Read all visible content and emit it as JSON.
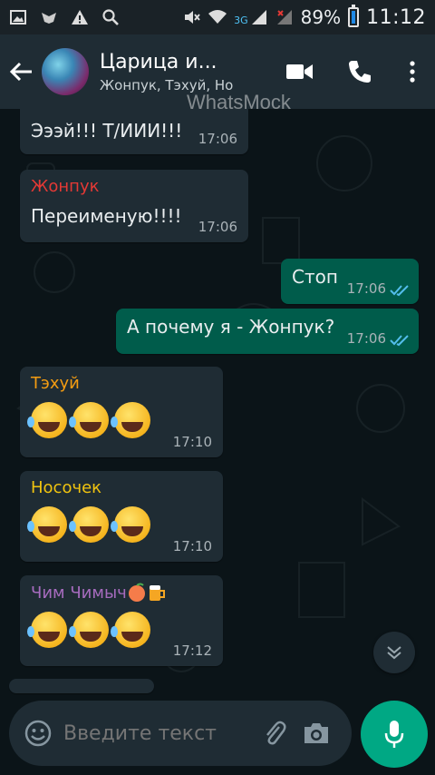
{
  "status_bar": {
    "network_label": "3G",
    "battery": "89%",
    "time": "11:12"
  },
  "header": {
    "title": "Царица и...",
    "subtitle": "Жонпук, Тэхуй, Но",
    "watermark": "WhatsMock"
  },
  "messages": [
    {
      "direction": "in",
      "text": "Эээй!!! Т/ИИИ!!!",
      "time": "17:06"
    },
    {
      "direction": "in",
      "sender": "Жонпук",
      "sender_color": "#e53935",
      "text": "Переименую!!!!",
      "time": "17:06"
    },
    {
      "direction": "out",
      "text": "Стоп",
      "time": "17:06",
      "status": "read"
    },
    {
      "direction": "out",
      "text": "А почему я - Жонпук?",
      "time": "17:06",
      "status": "read"
    },
    {
      "direction": "in",
      "sender": "Тэхуй",
      "sender_color": "#f39c12",
      "emoji": [
        "rofl-emoji",
        "rofl-emoji",
        "rofl-emoji"
      ],
      "time": "17:10"
    },
    {
      "direction": "in",
      "sender": "Носочек",
      "sender_color": "#f1c40f",
      "emoji": [
        "joy-emoji",
        "joy-emoji",
        "joy-emoji"
      ],
      "time": "17:10"
    },
    {
      "direction": "in",
      "sender": "Чим Чимыч",
      "sender_color": "#a66bbe",
      "sender_emoji": [
        "peach-emoji",
        "beer-emoji"
      ],
      "emoji": [
        "rofl-emoji",
        "rofl-emoji",
        "rofl-emoji"
      ],
      "time": "17:12"
    }
  ],
  "input": {
    "placeholder": "Введите текст"
  },
  "colors": {
    "header_bg": "#1f2c34",
    "incoming_bubble": "#1f2c34",
    "outgoing_bubble": "#005c4b",
    "accent": "#00a884",
    "read_ticks": "#53bdeb"
  }
}
